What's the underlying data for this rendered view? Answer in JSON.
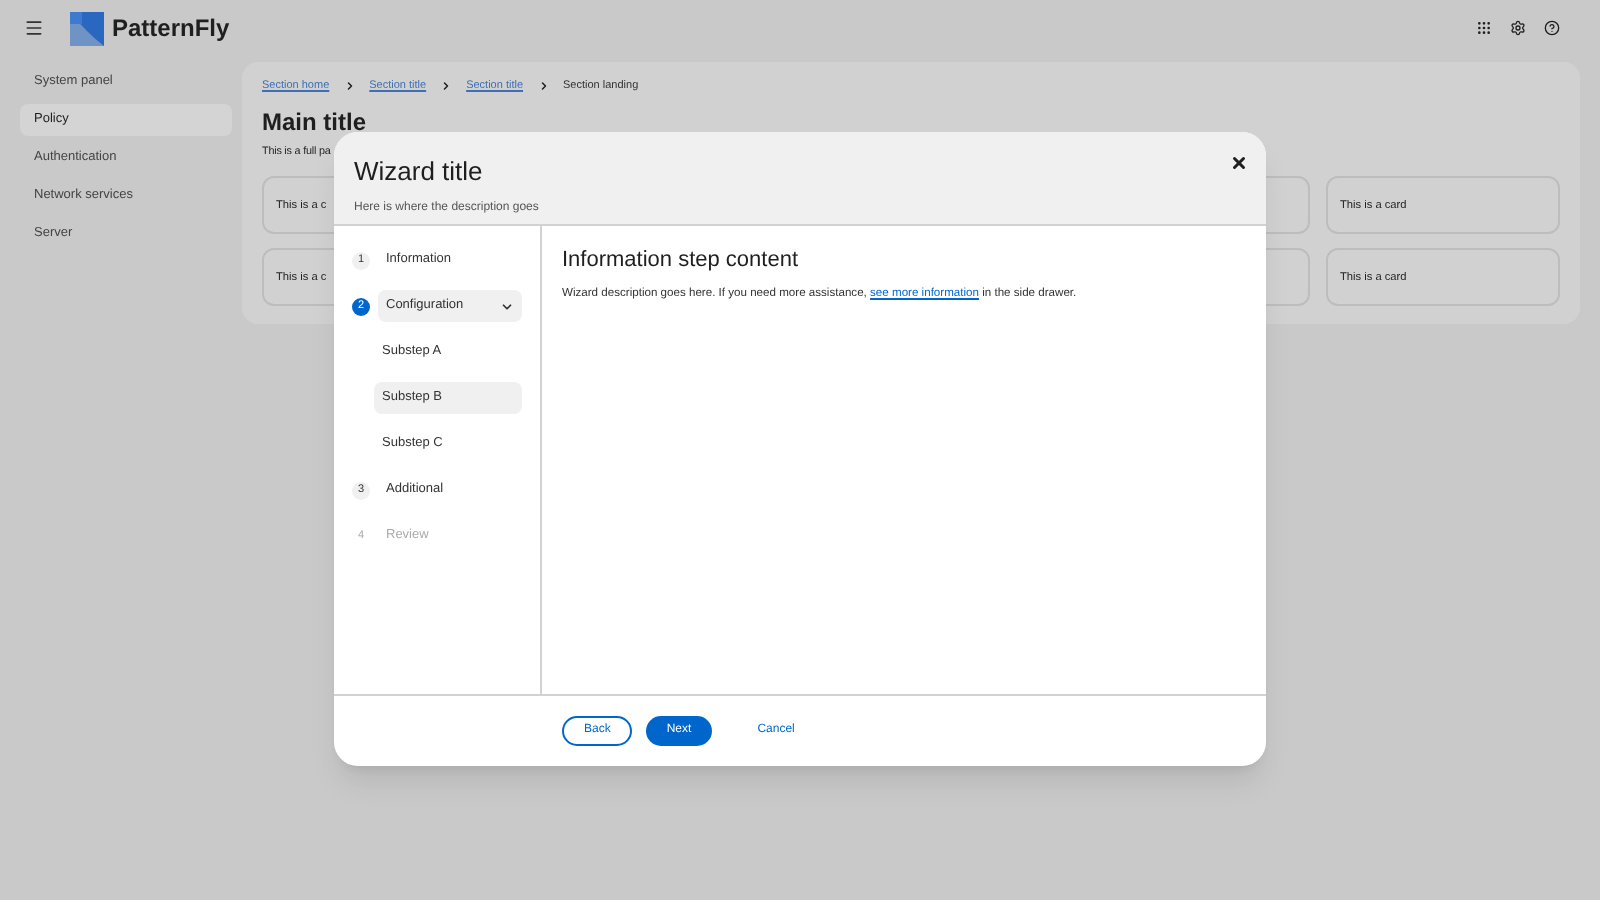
{
  "header": {
    "brand": "PatternFly"
  },
  "sidebar": {
    "items": [
      {
        "label": "System panel",
        "selected": false
      },
      {
        "label": "Policy",
        "selected": true
      },
      {
        "label": "Authentication",
        "selected": false
      },
      {
        "label": "Network services",
        "selected": false
      },
      {
        "label": "Server",
        "selected": false
      }
    ]
  },
  "breadcrumb": [
    {
      "label": "Section home",
      "kind": "link"
    },
    {
      "label": "Section title",
      "kind": "link"
    },
    {
      "label": "Section title",
      "kind": "link"
    },
    {
      "label": "Section landing",
      "kind": "current"
    }
  ],
  "main": {
    "title": "Main title",
    "description": "This is a full pa",
    "card_rows": [
      [
        {
          "label": "This is a c"
        },
        {},
        {
          "label": "This is a card"
        }
      ],
      [
        {
          "label": "This is a c"
        },
        {},
        {
          "label": "This is a card"
        }
      ]
    ]
  },
  "wizard": {
    "title": "Wizard title",
    "description": "Here is where the description goes",
    "steps": [
      {
        "number": "1",
        "label": "Information",
        "selected": false,
        "disabled": false
      },
      {
        "number": "2",
        "label": "Configuration",
        "selected": true,
        "disabled": false,
        "expanded": true,
        "children": [
          {
            "label": "Substep A",
            "selected": false
          },
          {
            "label": "Substep B",
            "selected": true
          },
          {
            "label": "Substep C",
            "selected": false
          }
        ]
      },
      {
        "number": "3",
        "label": "Additional",
        "selected": false,
        "disabled": false
      },
      {
        "number": "4",
        "label": "Review",
        "selected": false,
        "disabled": true
      }
    ],
    "content_title": "Information step content",
    "content_text": [
      "Wizard description goes here. If you need more assistance, ",
      "see more information",
      " in the side drawer."
    ],
    "buttons": [
      {
        "label": "Back",
        "kind": "secondary"
      },
      {
        "label": "Next",
        "kind": "primary"
      },
      {
        "label": "Cancel",
        "kind": "link"
      }
    ]
  }
}
